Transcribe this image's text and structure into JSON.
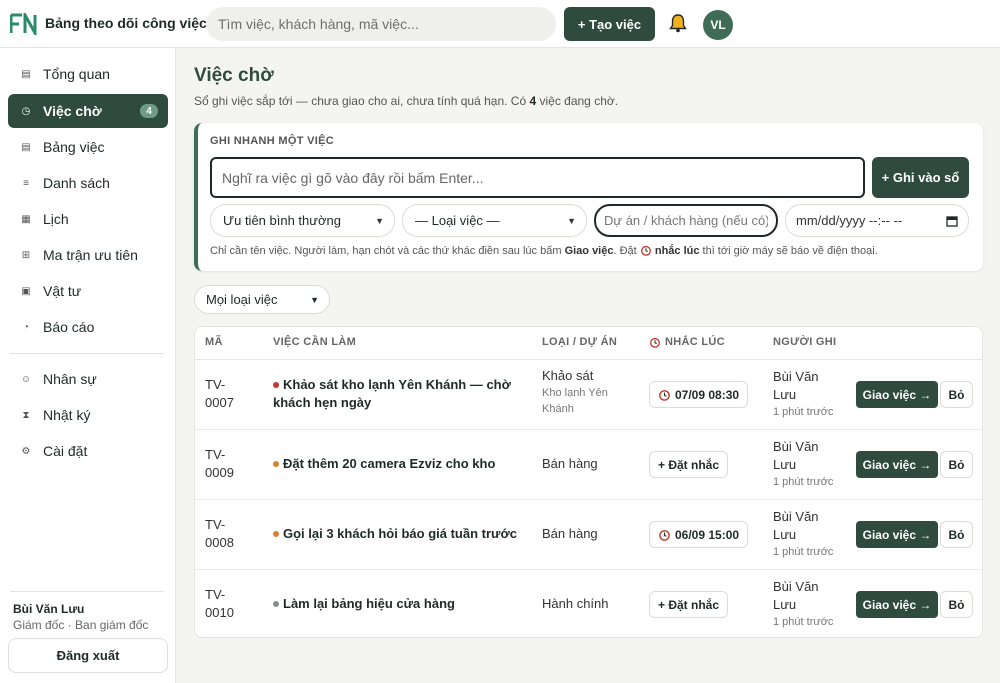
{
  "header": {
    "title": "Bảng theo dõi công việc",
    "search_placeholder": "Tìm việc, khách hàng, mã việc...",
    "create_label": "+  Tạo việc",
    "avatar_initials": "VL"
  },
  "sidebar": {
    "items": [
      {
        "label": "Tổng quan",
        "icon": "grid-icon"
      },
      {
        "label": "Việc chờ",
        "icon": "clock-icon",
        "badge": "4",
        "active": true
      },
      {
        "label": "Bảng việc",
        "icon": "board-icon"
      },
      {
        "label": "Danh sách",
        "icon": "list-icon"
      },
      {
        "label": "Lịch",
        "icon": "calendar-icon"
      },
      {
        "label": "Ma trận ưu tiên",
        "icon": "matrix-icon"
      },
      {
        "label": "Vật tư",
        "icon": "box-icon"
      },
      {
        "label": "Báo cáo",
        "icon": "pie-icon"
      },
      {
        "label": "Nhân sự",
        "icon": "user-icon"
      },
      {
        "label": "Nhật ký",
        "icon": "hourglass-icon"
      },
      {
        "label": "Cài đặt",
        "icon": "gear-icon"
      }
    ],
    "user_name": "Bùi Văn Lưu",
    "user_role": "Giám đốc · Ban giám đốc",
    "logout_label": "Đăng xuất"
  },
  "page": {
    "title": "Việc chờ",
    "subtitle_prefix": "Sổ ghi việc sắp tới — chưa giao cho ai, chưa tính quá hạn. Có ",
    "subtitle_count": "4",
    "subtitle_suffix": " việc đang chờ."
  },
  "quick": {
    "heading": "GHI NHANH MỘT VIỆC",
    "input_placeholder": "Nghĩ ra việc gì gõ vào đây rồi bấm Enter...",
    "save_label": "+ Ghi vào sổ",
    "priority_value": "Ưu tiên bình thường",
    "type_value": "— Loại việc —",
    "project_placeholder": "Dự án / khách hàng (nếu có)",
    "date_placeholder": "mm/dd/yyyy --:-- --",
    "hint_1": "Chỉ cần tên việc. Người làm, hạn chót và các thứ khác điền sau lúc bấm ",
    "hint_bold_1": "Giao việc",
    "hint_2": ". Đặt ",
    "hint_bold_2": "nhắc lúc",
    "hint_3": " thì tới giờ máy sẽ báo về điện thoại."
  },
  "filter": {
    "value": "Mọi loại việc"
  },
  "table": {
    "headers": {
      "code": "MÃ",
      "task": "VIỆC CẦN LÀM",
      "type": "LOẠI / DỰ ÁN",
      "remind": "NHẮC LÚC",
      "user": "NGƯỜI GHI"
    },
    "rows": [
      {
        "code": "TV-0007",
        "dot_color": "#c0392b",
        "task": "Khảo sát kho lạnh Yên Khánh — chờ khách hẹn ngày",
        "type": "Khảo sát",
        "project": "Kho lạnh Yên Khánh",
        "remind": "07/09 08:30",
        "has_time": true,
        "user": "Bùi Văn Lưu",
        "ago": "1 phút trước",
        "assign": "Giao việc →",
        "skip": "Bỏ"
      },
      {
        "code": "TV-0009",
        "dot_color": "#d9822b",
        "task": "Đặt thêm 20 camera Ezviz cho kho",
        "type": "Bán hàng",
        "project": "",
        "remind": "+ Đặt nhắc",
        "has_time": false,
        "user": "Bùi Văn Lưu",
        "ago": "1 phút trước",
        "assign": "Giao việc →",
        "skip": "Bỏ"
      },
      {
        "code": "TV-0008",
        "dot_color": "#d9822b",
        "task": "Gọi lại 3 khách hỏi báo giá tuần trước",
        "type": "Bán hàng",
        "project": "",
        "remind": "06/09 15:00",
        "has_time": true,
        "user": "Bùi Văn Lưu",
        "ago": "1 phút trước",
        "assign": "Giao việc →",
        "skip": "Bỏ"
      },
      {
        "code": "TV-0010",
        "dot_color": "#8a8f8c",
        "task": "Làm lại bảng hiệu cửa hàng",
        "type": "Hành chính",
        "project": "",
        "remind": "+ Đặt nhắc",
        "has_time": false,
        "user": "Bùi Văn Lưu",
        "ago": "1 phút trước",
        "assign": "Giao việc →",
        "skip": "Bỏ"
      }
    ]
  },
  "colors": {
    "accent": "#2f4a3e",
    "badge": "#6f9c84",
    "bell": "#f2b01e"
  }
}
